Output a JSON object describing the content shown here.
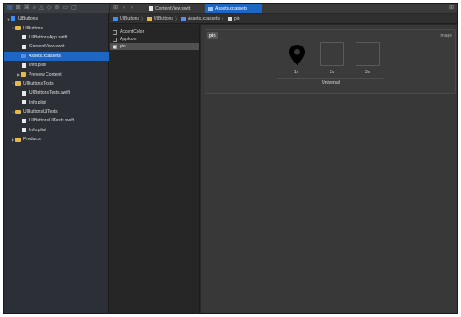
{
  "navigator": {
    "toolbar_icons": [
      "folder-icon",
      "source-control-icon",
      "symbol-icon",
      "search-icon",
      "issue-icon",
      "test-icon",
      "debug-icon",
      "breakpoint-icon",
      "report-icon"
    ],
    "items": [
      {
        "label": "UIButtons",
        "type": "project",
        "expanded": true,
        "level": 0
      },
      {
        "label": "UIButtons",
        "type": "folder",
        "expanded": true,
        "level": 1
      },
      {
        "label": "UIButtonsApp.swift",
        "type": "file",
        "level": 2
      },
      {
        "label": "ContentView.swift",
        "type": "file",
        "level": 2
      },
      {
        "label": "Assets.xcassets",
        "type": "assets",
        "level": 2,
        "selected": true
      },
      {
        "label": "Info.plist",
        "type": "file",
        "level": 2
      },
      {
        "label": "Preview Content",
        "type": "folder",
        "expanded": false,
        "level": 2
      },
      {
        "label": "UIButtonsTests",
        "type": "folder",
        "expanded": true,
        "level": 1
      },
      {
        "label": "UIButtonsTests.swift",
        "type": "file",
        "level": 2
      },
      {
        "label": "Info.plist",
        "type": "file",
        "level": 2
      },
      {
        "label": "UIButtonsUITests",
        "type": "folder",
        "expanded": true,
        "level": 1
      },
      {
        "label": "UIButtonsUITests.swift",
        "type": "file",
        "level": 2
      },
      {
        "label": "Info.plist",
        "type": "file",
        "level": 2
      },
      {
        "label": "Products",
        "type": "folder",
        "expanded": false,
        "level": 1
      }
    ]
  },
  "tabs": [
    {
      "label": "ContentView.swift",
      "active": false
    },
    {
      "label": "Assets.xcassets",
      "active": true
    }
  ],
  "breadcrumb": [
    "UIButtons",
    "UIButtons",
    "Assets.xcassets",
    "pin"
  ],
  "asset_list": [
    {
      "label": "AccentColor",
      "selected": false
    },
    {
      "label": "AppIcon",
      "selected": false
    },
    {
      "label": "pin",
      "selected": true
    }
  ],
  "image_set": {
    "name": "pin",
    "type_label": "Image",
    "slots": [
      "1x",
      "2x",
      "3x"
    ],
    "group_label": "Universal"
  },
  "colors": {
    "accent": "#1e66c4",
    "folder": "#e4b94a"
  }
}
